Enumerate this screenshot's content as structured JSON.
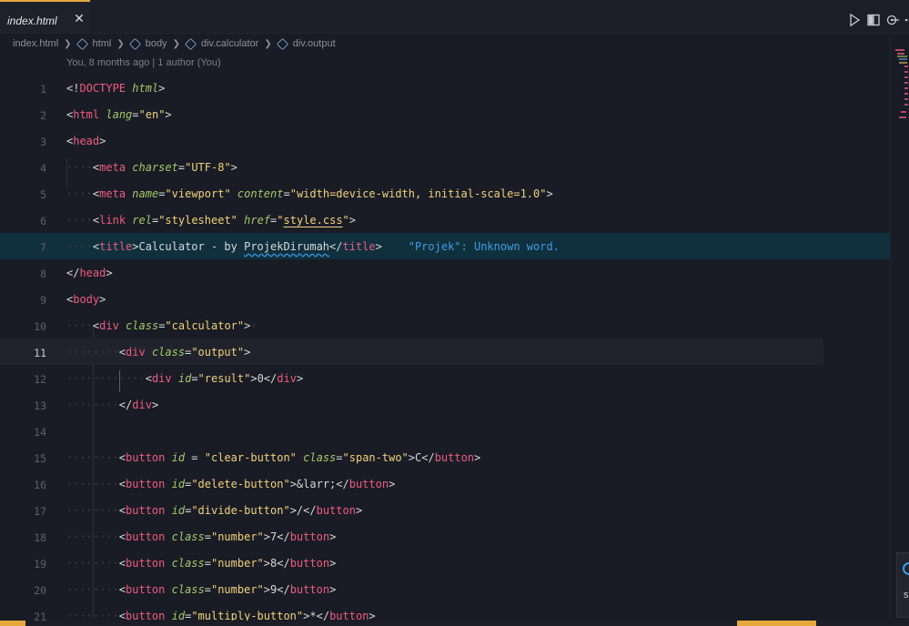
{
  "tabs": [
    {
      "label": "index.html",
      "active": true,
      "close_glyph": "✕"
    }
  ],
  "toolbar_icons": [
    "run-icon",
    "split-editor-icon",
    "compare-changes-icon",
    "more-actions-icon"
  ],
  "breadcrumb": {
    "file": "index.html",
    "items": [
      "html",
      "body",
      "div.calculator",
      "div.output"
    ]
  },
  "blame": "You, 8 months ago | 1 author (You)",
  "diagnostic": "\"Projek\": Unknown word.",
  "current_line": "11",
  "lines": [
    {
      "n": "1"
    },
    {
      "n": "2"
    },
    {
      "n": "3"
    },
    {
      "n": "4"
    },
    {
      "n": "5"
    },
    {
      "n": "6"
    },
    {
      "n": "7"
    },
    {
      "n": "8"
    },
    {
      "n": "9"
    },
    {
      "n": "10"
    },
    {
      "n": "11"
    },
    {
      "n": "12"
    },
    {
      "n": "13"
    },
    {
      "n": "14"
    },
    {
      "n": "15"
    },
    {
      "n": "16"
    },
    {
      "n": "17"
    },
    {
      "n": "18"
    },
    {
      "n": "19"
    },
    {
      "n": "20"
    },
    {
      "n": "21"
    }
  ],
  "code": {
    "l1": {
      "open": "<!",
      "doctype": "DOCTYPE",
      "html": "html",
      "close": ">"
    },
    "l2": {
      "tag": "html",
      "attr": "lang",
      "val": "\"en\""
    },
    "l3": {
      "tag": "head"
    },
    "l4": {
      "tag": "meta",
      "attr": "charset",
      "val": "\"UTF-8\""
    },
    "l5": {
      "tag": "meta",
      "attr1": "name",
      "val1": "\"viewport\"",
      "attr2": "content",
      "val2": "\"width=device-width, initial-scale=1.0\""
    },
    "l6": {
      "tag": "link",
      "attr1": "rel",
      "val1": "\"stylesheet\"",
      "attr2": "href",
      "val2_q1": "\"",
      "val2": "style.css",
      "val2_q2": "\""
    },
    "l7": {
      "tag": "title",
      "text1": "Calculator - by ",
      "text2": "ProjekDirumah"
    },
    "l8": {
      "tag": "head"
    },
    "l9": {
      "tag": "body"
    },
    "l10": {
      "tag": "div",
      "attr": "class",
      "val": "\"calculator\""
    },
    "l11": {
      "tag": "div",
      "attr": "class",
      "val": "\"output\""
    },
    "l12": {
      "tag": "div",
      "attr": "id",
      "val": "\"result\"",
      "text": "0"
    },
    "l13": {
      "tag": "div"
    },
    "l15": {
      "tag": "button",
      "attr1": "id",
      "eq": " = ",
      "val1": "\"clear-button\"",
      "attr2": "class",
      "val2": "\"span-two\"",
      "text": "C"
    },
    "l16": {
      "tag": "button",
      "attr": "id",
      "val": "\"delete-button\"",
      "text": "&larr;"
    },
    "l17": {
      "tag": "button",
      "attr": "id",
      "val": "\"divide-button\"",
      "text": "/"
    },
    "l18": {
      "tag": "button",
      "attr": "class",
      "val": "\"number\"",
      "text": "7"
    },
    "l19": {
      "tag": "button",
      "attr": "class",
      "val": "\"number\"",
      "text": "8"
    },
    "l20": {
      "tag": "button",
      "attr": "class",
      "val": "\"number\"",
      "text": "9"
    },
    "l21": {
      "tag": "button",
      "attr": "id",
      "val": "\"multiply-button\"",
      "text": "*"
    }
  },
  "notification": {
    "letter": "s"
  },
  "colors": {
    "background": "#191c25",
    "tag": "#f05a7e",
    "attribute": "#a3c868",
    "string": "#f2d07a",
    "diagnostic": "#3f9be6",
    "accent": "#e5a93b"
  }
}
